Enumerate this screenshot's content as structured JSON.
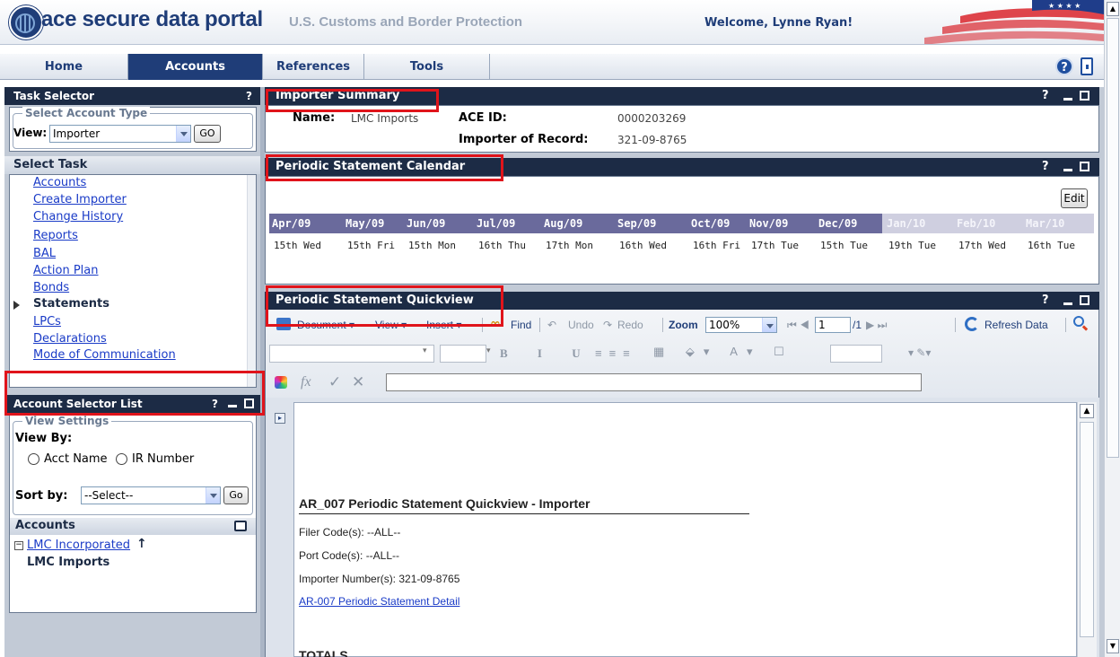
{
  "header": {
    "portal_name": "ace secure data portal",
    "agency": "U.S. Customs and Border Protection",
    "welcome": "Welcome, Lynne Ryan!"
  },
  "nav": {
    "tabs": [
      "Home",
      "Accounts",
      "References",
      "Tools"
    ],
    "active": "Accounts",
    "help": "?"
  },
  "task_selector": {
    "title": "Task Selector",
    "help": "?",
    "legend": "Select Account Type",
    "view_label": "View:",
    "view_value": "Importer",
    "go": "GO",
    "select_task": "Select Task",
    "tasks": [
      "Accounts",
      "Create Importer",
      "Change History",
      "Reports",
      "BAL",
      "Action Plan",
      "Bonds",
      "Statements",
      "LPCs",
      "Declarations",
      "Mode of Communication"
    ],
    "current_task": "Statements"
  },
  "account_selector": {
    "title": "Account Selector List",
    "help": "?",
    "legend": "View Settings",
    "view_by": "View By:",
    "option_acct": "Acct Name",
    "option_ir": "IR Number",
    "sort_by": "Sort by:",
    "sort_value": "--Select--",
    "go": "Go",
    "accounts_title": "Accounts",
    "tree_parent": "LMC Incorporated",
    "tree_child": "LMC Imports"
  },
  "importer_summary": {
    "title": "Importer Summary",
    "name_label": "Name:",
    "name_value": "LMC Imports",
    "ace_label": "ACE ID:",
    "ace_value": "0000203269",
    "ior_label": "Importer of Record:",
    "ior_value": "321-09-8765"
  },
  "calendar": {
    "title": "Periodic Statement Calendar",
    "edit": "Edit",
    "months": [
      "Apr/09",
      "May/09",
      "Jun/09",
      "Jul/09",
      "Aug/09",
      "Sep/09",
      "Oct/09",
      "Nov/09",
      "Dec/09",
      "Jan/10",
      "Feb/10",
      "Mar/10"
    ],
    "days": [
      "15th Wed",
      "15th Fri",
      "15th Mon",
      "16th Thu",
      "17th Mon",
      "16th Wed",
      "16th Fri",
      "17th Tue",
      "15th Tue",
      "19th Tue",
      "17th Wed",
      "16th Tue"
    ],
    "active_count": 9
  },
  "quickview": {
    "title": "Periodic Statement Quickview",
    "toolbar": {
      "document": "Document",
      "view": "View",
      "insert": "Insert",
      "find": "Find",
      "undo": "Undo",
      "redo": "Redo",
      "zoom_label": "Zoom",
      "zoom_value": "100%",
      "page_value": "1",
      "page_total": "/1",
      "refresh": "Refresh Data"
    },
    "report": {
      "title": "AR_007 Periodic Statement Quickview - Importer",
      "filer": "Filer Code(s): --ALL--",
      "port": "Port Code(s): --ALL--",
      "importer": "Importer Number(s): 321-09-8765",
      "link": "AR-007 Periodic Statement Detail",
      "totals": "TOTALS"
    }
  }
}
